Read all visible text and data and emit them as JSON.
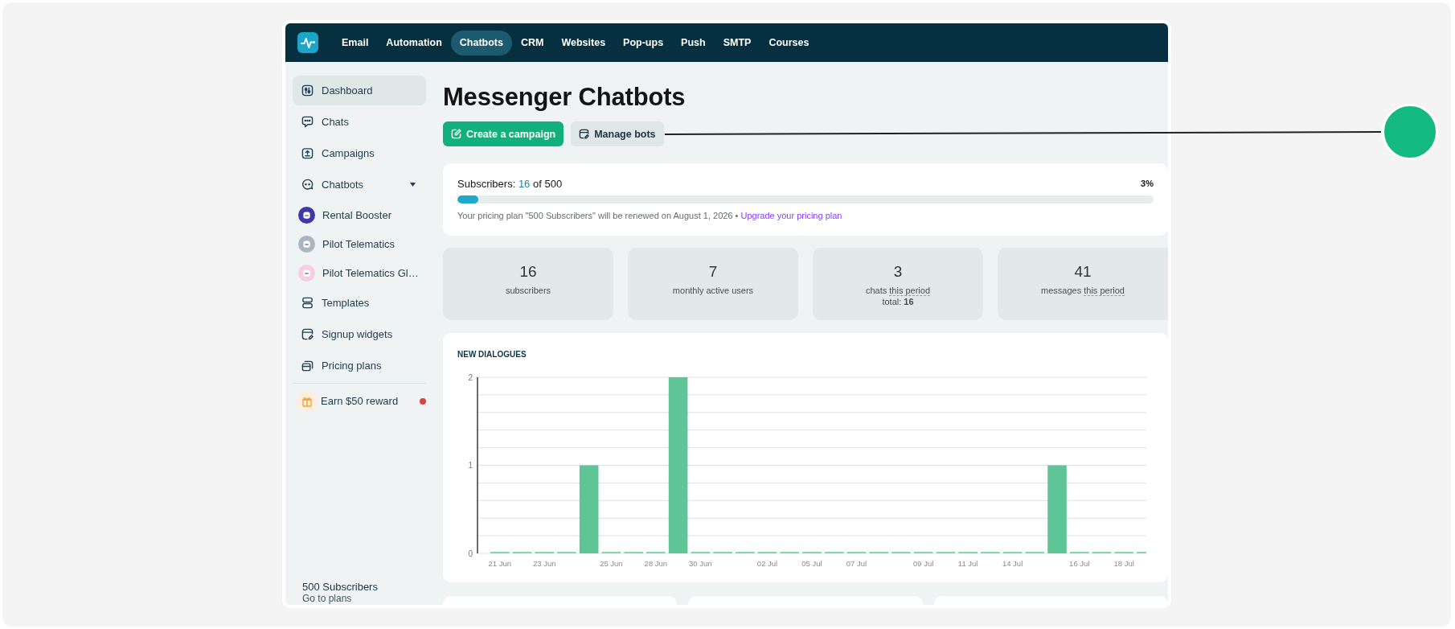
{
  "nav": {
    "items": [
      {
        "label": "Email",
        "selected": false
      },
      {
        "label": "Automation",
        "selected": false
      },
      {
        "label": "Chatbots",
        "selected": true
      },
      {
        "label": "CRM",
        "selected": false
      },
      {
        "label": "Websites",
        "selected": false
      },
      {
        "label": "Pop-ups",
        "selected": false
      },
      {
        "label": "Push",
        "selected": false
      },
      {
        "label": "SMTP",
        "selected": false
      },
      {
        "label": "Courses",
        "selected": false
      }
    ]
  },
  "sidebar": {
    "items": [
      {
        "kind": "link",
        "label": "Dashboard",
        "selected": true
      },
      {
        "kind": "link",
        "label": "Chats",
        "selected": false
      },
      {
        "kind": "link",
        "label": "Campaigns",
        "selected": false
      },
      {
        "kind": "group",
        "label": "Chatbots",
        "selected": false,
        "expanded": true
      },
      {
        "kind": "bot",
        "label": "Rental Booster",
        "selected": false,
        "color": "#3d3aa8"
      },
      {
        "kind": "bot",
        "label": "Pilot Telematics",
        "selected": false,
        "color": "#a9b6bf"
      },
      {
        "kind": "bot",
        "label": "Pilot Telematics Gl…",
        "selected": false,
        "color": "#f8cce3"
      },
      {
        "kind": "link",
        "label": "Templates",
        "selected": false
      },
      {
        "kind": "link",
        "label": "Signup widgets",
        "selected": false
      },
      {
        "kind": "link",
        "label": "Pricing plans",
        "selected": false
      },
      {
        "kind": "reward",
        "label": "Earn $50 reward",
        "selected": false,
        "unread": true
      }
    ],
    "footer": {
      "plan": "500 Subscribers",
      "link": "Go to plans"
    }
  },
  "page": {
    "title": "Messenger Chatbots",
    "buttons": [
      {
        "kind": "primary",
        "label": "Create a campaign"
      },
      {
        "kind": "secondary",
        "label": "Manage bots"
      }
    ]
  },
  "subscription": {
    "label": "Subscribers:",
    "used": "16",
    "limit": "of 500",
    "percent": "3%",
    "level": 0.03,
    "note": "Your pricing plan \"500 Subscribers\" will be renewed on August 1, 2026 •",
    "link": "Upgrade your pricing plan"
  },
  "stats": [
    {
      "value": "16",
      "label": "subscribers"
    },
    {
      "value": "7",
      "label": "monthly active users"
    },
    {
      "value": "3",
      "label": "chats",
      "hint": "this period",
      "total": "total: **16**"
    },
    {
      "value": "41",
      "label": "messages",
      "hint": "this period"
    }
  ],
  "chart": {
    "chart_data": {
      "type": "bar",
      "title": "NEW DIALOGUES",
      "categories": [
        "21 Jun",
        null,
        "23 Jun",
        null,
        null,
        "25 Jun",
        null,
        "28 Jun",
        null,
        "30 Jun",
        null,
        null,
        "02 Jul",
        null,
        "05 Jul",
        null,
        "07 Jul",
        null,
        null,
        "09 Jul",
        null,
        "11 Jul",
        null,
        "14 Jul",
        null,
        null,
        "16 Jul",
        null,
        "18 Jul",
        null
      ],
      "values": [
        0,
        0,
        0,
        0,
        1,
        0,
        0,
        0,
        2,
        0,
        0,
        0,
        0,
        0,
        0,
        0,
        0,
        0,
        0,
        0,
        0,
        0,
        0,
        0,
        0,
        1,
        0,
        0,
        0,
        0
      ],
      "ylim": [
        0,
        2
      ],
      "yticks": [
        0,
        1,
        2
      ]
    }
  }
}
